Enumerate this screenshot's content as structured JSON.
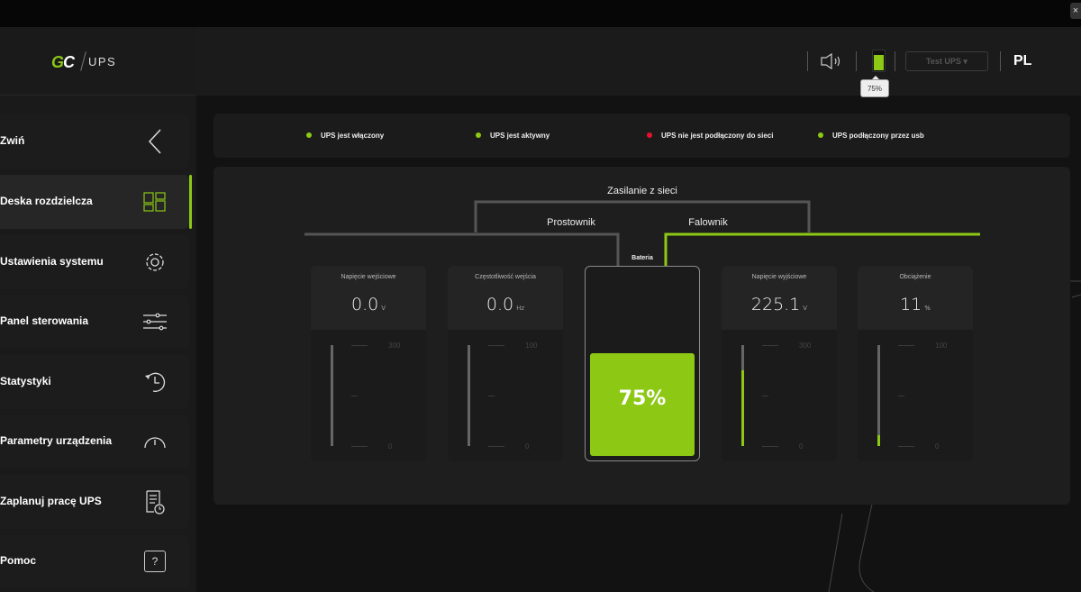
{
  "window": {
    "close_label": "×"
  },
  "logo": {
    "brand": "GC",
    "product": "UPS"
  },
  "sidebar": {
    "items": [
      {
        "label": "Zwiń",
        "icon": "chevron-left-icon"
      },
      {
        "label": "Deska rozdzielcza",
        "icon": "dashboard-icon",
        "active": true
      },
      {
        "label": "Ustawienia systemu",
        "icon": "gear-icon"
      },
      {
        "label": "Panel sterowania",
        "icon": "sliders-icon"
      },
      {
        "label": "Statystyki",
        "icon": "history-icon"
      },
      {
        "label": "Parametry urządzenia",
        "icon": "gauge-icon"
      },
      {
        "label": "Zaplanuj pracę UPS",
        "icon": "schedule-icon"
      },
      {
        "label": "Pomoc",
        "icon": "help-icon",
        "glyph": "?"
      }
    ]
  },
  "header": {
    "device_select": "Test UPS",
    "language": "PL",
    "battery_tooltip": "75%",
    "battery_level": 75
  },
  "status": [
    {
      "label": "UPS jest włączony",
      "color": "#8cc814"
    },
    {
      "label": "UPS jest aktywny",
      "color": "#8cc814"
    },
    {
      "label": "UPS nie jest podłączony do sieci",
      "color": "#e8112d"
    },
    {
      "label": "UPS podłączony przez usb",
      "color": "#8cc814"
    }
  ],
  "diagram": {
    "mains": "Zasilanie z sieci",
    "rectifier": "Prostownik",
    "inverter": "Falownik",
    "battery_label": "Bateria",
    "battery_value": "75%",
    "battery_level": 75
  },
  "cards": [
    {
      "title": "Napięcie wejściowe",
      "value": "0.0",
      "unit": "V",
      "max": "300",
      "min": "0",
      "level": 0
    },
    {
      "title": "Częstotliwość wejścia",
      "value": "0.0",
      "unit": "Hz",
      "max": "100",
      "min": "0",
      "level": 0
    },
    {
      "title": "Napięcie wyjściowe",
      "value": "225.1",
      "unit": "V",
      "max": "300",
      "min": "0",
      "level": 75
    },
    {
      "title": "Obciążenie",
      "value": "11",
      "unit": "%",
      "max": "100",
      "min": "0",
      "level": 11
    }
  ],
  "colors": {
    "accent": "#8cc814",
    "error": "#e8112d"
  }
}
